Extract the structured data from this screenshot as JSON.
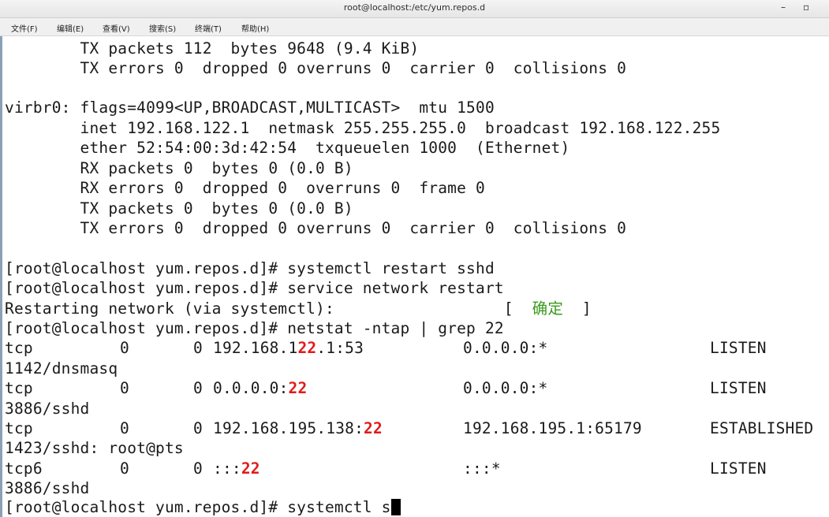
{
  "window": {
    "title": "root@localhost:/etc/yum.repos.d",
    "minimize_glyph": "–",
    "maximize_glyph": "▫"
  },
  "menu": {
    "items": [
      "文件(F)",
      "编辑(E)",
      "查看(V)",
      "搜索(S)",
      "终端(T)",
      "帮助(H)"
    ]
  },
  "terminal": {
    "lines": [
      {
        "id": "l01",
        "text": "        TX packets 112  bytes 9648 (9.4 KiB)"
      },
      {
        "id": "l02",
        "text": "        TX errors 0  dropped 0 overruns 0  carrier 0  collisions 0"
      },
      {
        "id": "l03",
        "text": ""
      },
      {
        "id": "l04",
        "text": "virbr0: flags=4099<UP,BROADCAST,MULTICAST>  mtu 1500"
      },
      {
        "id": "l05",
        "text": "        inet 192.168.122.1  netmask 255.255.255.0  broadcast 192.168.122.255"
      },
      {
        "id": "l06",
        "text": "        ether 52:54:00:3d:42:54  txqueuelen 1000  (Ethernet)"
      },
      {
        "id": "l07",
        "text": "        RX packets 0  bytes 0 (0.0 B)"
      },
      {
        "id": "l08",
        "text": "        RX errors 0  dropped 0  overruns 0  frame 0"
      },
      {
        "id": "l09",
        "text": "        TX packets 0  bytes 0 (0.0 B)"
      },
      {
        "id": "l10",
        "text": "        TX errors 0  dropped 0 overruns 0  carrier 0  collisions 0"
      },
      {
        "id": "l11",
        "text": ""
      },
      {
        "id": "l12",
        "text": "[root@localhost yum.repos.d]# systemctl restart sshd"
      },
      {
        "id": "l13",
        "text": "[root@localhost yum.repos.d]# service network restart"
      },
      {
        "id": "l14a",
        "text": "Restarting network (via systemctl):                  [  "
      },
      {
        "id": "l14b",
        "text": "确定"
      },
      {
        "id": "l14c",
        "text": "  ]"
      },
      {
        "id": "l15",
        "text": "[root@localhost yum.repos.d]# netstat -ntap | grep 22"
      }
    ],
    "netstat": [
      {
        "proto": "tcp ",
        "recv": "0",
        "send": "0",
        "local_pre": "192.168.1",
        "local_hl": "22",
        "local_post": ".1:53",
        "foreign": "0.0.0.0:*",
        "state": "LISTEN",
        "pid": "1142/dnsmasq"
      },
      {
        "proto": "tcp ",
        "recv": "0",
        "send": "0",
        "local_pre": "0.0.0.0:",
        "local_hl": "22",
        "local_post": "",
        "foreign": "0.0.0.0:*",
        "state": "LISTEN",
        "pid": "3886/sshd"
      },
      {
        "proto": "tcp ",
        "recv": "0",
        "send": "0",
        "local_pre": "192.168.195.138:",
        "local_hl": "22",
        "local_post": "",
        "foreign": "192.168.195.1:65179",
        "state": "ESTABLISHED",
        "pid": "1423/sshd: root@pts"
      },
      {
        "proto": "tcp6",
        "recv": "0",
        "send": "0",
        "local_pre": ":::",
        "local_hl": "22",
        "local_post": "",
        "foreign": ":::*",
        "state": "LISTEN",
        "pid": "3886/sshd"
      }
    ],
    "prompt": "[root@localhost yum.repos.d]# ",
    "current_input": "systemctl s"
  },
  "colors": {
    "highlight_red": "#e01b1b",
    "ok_green": "#3a9a1e",
    "terminal_bg": "#ffffff",
    "terminal_fg": "#1a1a1a"
  }
}
